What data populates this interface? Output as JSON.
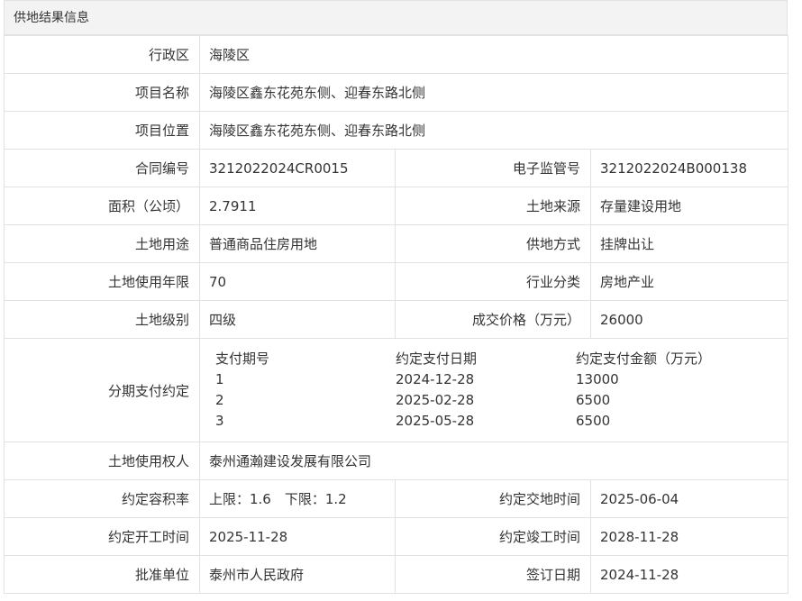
{
  "section_title": "供地结果信息",
  "district": {
    "label": "行政区",
    "value": "海陵区"
  },
  "project_name": {
    "label": "项目名称",
    "value": "海陵区鑫东花苑东侧、迎春东路北侧"
  },
  "project_location": {
    "label": "项目位置",
    "value": "海陵区鑫东花苑东侧、迎春东路北侧"
  },
  "contract_no": {
    "label": "合同编号",
    "value": "3212022024CR0015"
  },
  "supervision_no": {
    "label": "电子监管号",
    "value": "3212022024B000138"
  },
  "area": {
    "label": "面积（公顷）",
    "value": "2.7911"
  },
  "land_source": {
    "label": "土地来源",
    "value": "存量建设用地"
  },
  "land_use": {
    "label": "土地用途",
    "value": "普通商品住房用地"
  },
  "supply_method": {
    "label": "供地方式",
    "value": "挂牌出让"
  },
  "use_term": {
    "label": "土地使用年限",
    "value": "70"
  },
  "industry": {
    "label": "行业分类",
    "value": "房地产业"
  },
  "land_grade": {
    "label": "土地级别",
    "value": "四级"
  },
  "deal_price": {
    "label": "成交价格（万元）",
    "value": "26000"
  },
  "installments": {
    "label": "分期支付约定",
    "columns": [
      "支付期号",
      "约定支付日期",
      "约定支付金额（万元）"
    ],
    "rows": [
      [
        "1",
        "2024-12-28",
        "13000"
      ],
      [
        "2",
        "2025-02-28",
        "6500"
      ],
      [
        "3",
        "2025-05-28",
        "6500"
      ]
    ]
  },
  "land_user": {
    "label": "土地使用权人",
    "value": "泰州通瀚建设发展有限公司"
  },
  "plot_ratio": {
    "label": "约定容积率",
    "value": "上限：1.6　下限：1.2"
  },
  "handover_time": {
    "label": "约定交地时间",
    "value": "2025-06-04"
  },
  "start_time": {
    "label": "约定开工时间",
    "value": "2025-11-28"
  },
  "completion_time": {
    "label": "约定竣工时间",
    "value": "2028-11-28"
  },
  "approval_unit": {
    "label": "批准单位",
    "value": "泰州市人民政府"
  },
  "sign_date": {
    "label": "签订日期",
    "value": "2024-11-28"
  }
}
